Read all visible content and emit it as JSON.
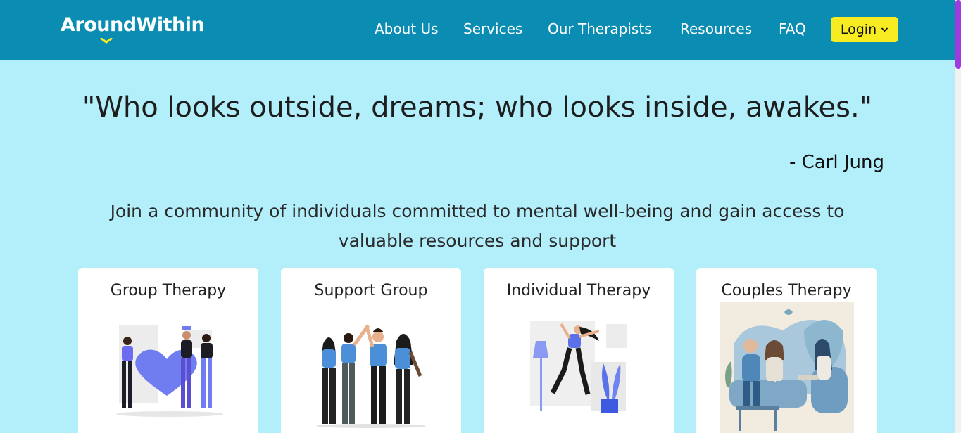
{
  "brand": {
    "name": "AroundWithin",
    "logo_color": "#ffffff",
    "accent": "#f7ec21"
  },
  "nav": {
    "items": [
      "About Us",
      "Services",
      "Our Therapists",
      "Resources",
      "FAQ"
    ],
    "login_label": "Login",
    "login_icon": "chevron-down-icon",
    "background": "#0b8db3"
  },
  "hero": {
    "quote": "\"Who looks outside, dreams; who looks inside, awakes.\"",
    "author": "- Carl Jung",
    "subtitle": "Join a community of individuals committed to mental well-being and gain access to valuable resources and support",
    "background": "#b3eefb"
  },
  "cards": [
    {
      "title": "Group Therapy",
      "image": "group-therapy-illustration"
    },
    {
      "title": "Support Group",
      "image": "support-group-illustration"
    },
    {
      "title": "Individual Therapy",
      "image": "individual-therapy-illustration"
    },
    {
      "title": "Couples Therapy",
      "image": "couples-therapy-illustration"
    }
  ]
}
